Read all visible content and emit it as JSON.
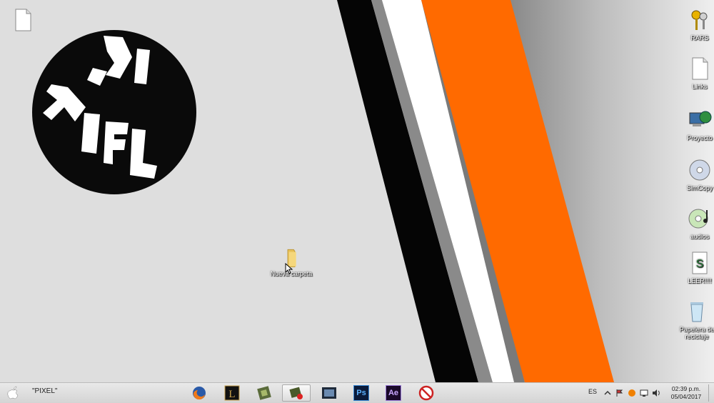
{
  "desktop": {
    "logo_text": "PIXEL",
    "icons": [
      {
        "name": "rars-icon",
        "label": "RARS"
      },
      {
        "name": "links-icon",
        "label": "Links"
      },
      {
        "name": "proyecto-icon",
        "label": "Proyecto"
      },
      {
        "name": "simcopy-icon",
        "label": "SimCopy"
      },
      {
        "name": "audios-icon",
        "label": "audios"
      },
      {
        "name": "leer-icon",
        "label": "LEER!!!!"
      },
      {
        "name": "recycle-bin-icon",
        "label": "Papelera de reciclaje"
      }
    ],
    "new_folder_label": "Nueva carpeta"
  },
  "taskbar": {
    "pinned_label": "\"PIXEL\"",
    "apps": [
      "firefox-icon",
      "league-of-legends-icon",
      "game-icon",
      "media-icon",
      "film-strip-icon",
      "photoshop-icon",
      "after-effects-icon",
      "blocked-icon"
    ],
    "ps_text": "Ps",
    "ae_text": "Ae",
    "lang": "ES",
    "time": "02:39 p.m.",
    "date": "05/04/2017"
  },
  "colors": {
    "orange": "#ff6a00",
    "black": "#000000",
    "white": "#ffffff",
    "desktop_bg": "#dedede"
  }
}
